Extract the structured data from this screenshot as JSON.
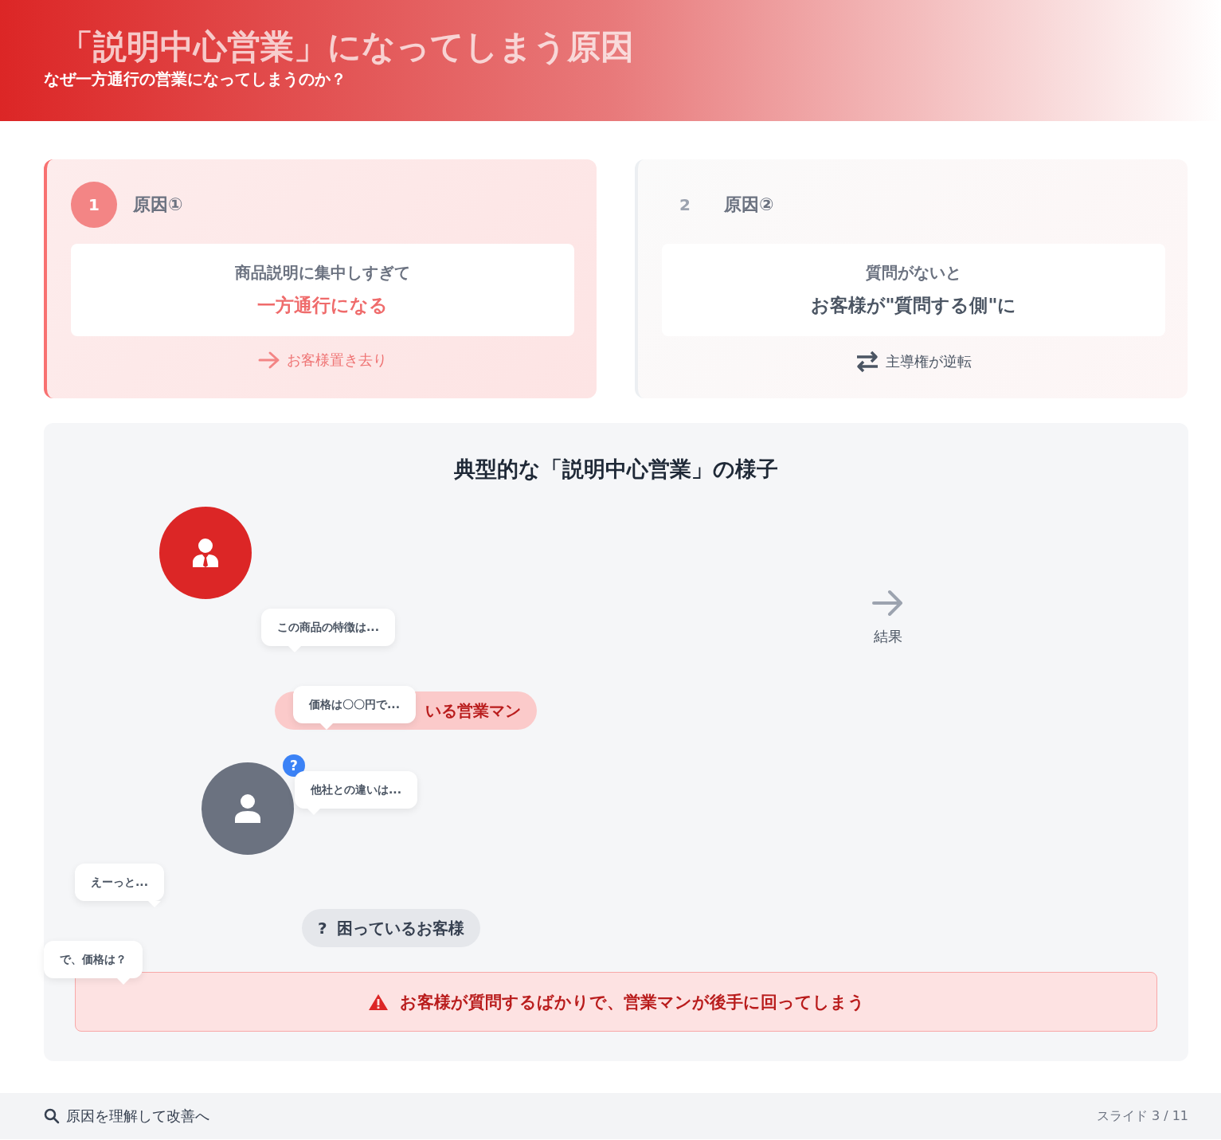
{
  "header": {
    "title": "「説明中心営業」になってしまう原因",
    "subtitle": "なぜ一方通行の営業になってしまうのか？"
  },
  "causes": [
    {
      "number": "1",
      "label": "原因①",
      "line1": "商品説明に集中しすぎて",
      "line2": "一方通行になる",
      "note": "お客様置き去り",
      "kind": "arrow",
      "emphasized": true
    },
    {
      "number": "2",
      "label": "原因②",
      "line1": "質問がないと",
      "line2": "お客様が\"質問する側\"に",
      "note": "主導権が逆転",
      "kind": "swap",
      "emphasized": false
    }
  ],
  "scene": {
    "title": "典型的な「説明中心営業」の様子",
    "salesperson_label": "いる営業マン",
    "customer_label_mark": "?",
    "customer_label": "困っているお客様",
    "question_badge": "?",
    "bubbles": [
      {
        "text": "この商品の特徴は..."
      },
      {
        "text": "価格は〇〇円で..."
      },
      {
        "text": "他社との違いは..."
      },
      {
        "text": "えーっと..."
      },
      {
        "text": "で、価格は？"
      }
    ],
    "result_label": "結果",
    "warning": "お客様が質問するばかりで、営業マンが後手に回ってしまう"
  },
  "footer": {
    "hint": "原因を理解して改善へ",
    "slide": "スライド 3 / 11"
  }
}
